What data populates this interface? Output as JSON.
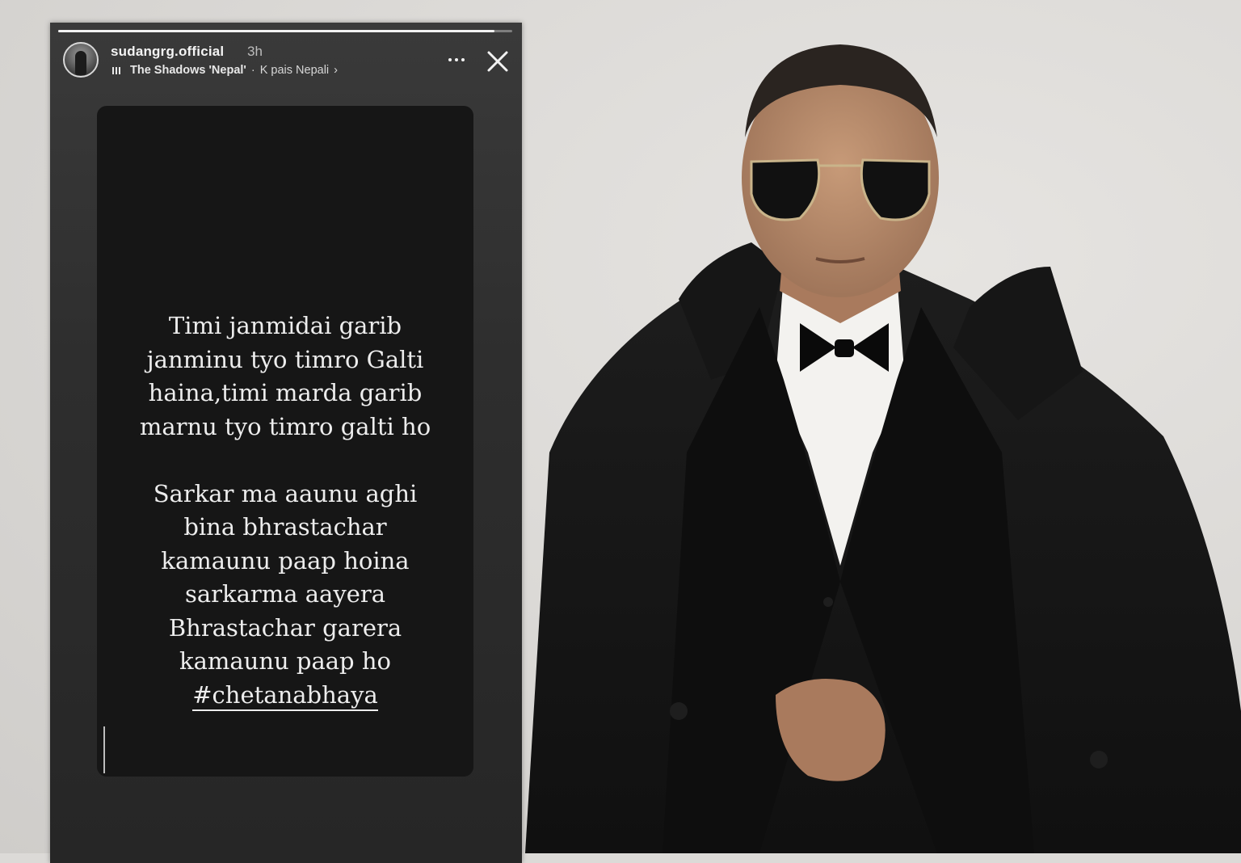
{
  "story": {
    "progress": 0.96,
    "username": "sudangrg.official",
    "timestamp": "3h",
    "music": {
      "song": "The Shadows 'Nepal'",
      "separator": "·",
      "artist": "K pais Nepali",
      "chevron": "›"
    },
    "icons": {
      "more": "more-options-icon",
      "close": "close-icon",
      "music": "music-bars-icon"
    },
    "card": {
      "lines": [
        "Timi janmidai garib",
        "janminu tyo timro Galti",
        "haina,timi marda garib",
        "marnu tyo timro galti ho",
        "",
        "Sarkar ma aaunu aghi",
        "bina bhrastachar",
        "kamaunu paap hoina",
        "sarkarma aayera",
        "Bhrastachar garera",
        "kamaunu paap ho"
      ],
      "hashtag": "#chetanabhaya"
    }
  },
  "colors": {
    "story_background": "#2e2e2e",
    "card_background": "#161616",
    "page_background": "#dcdad7"
  }
}
